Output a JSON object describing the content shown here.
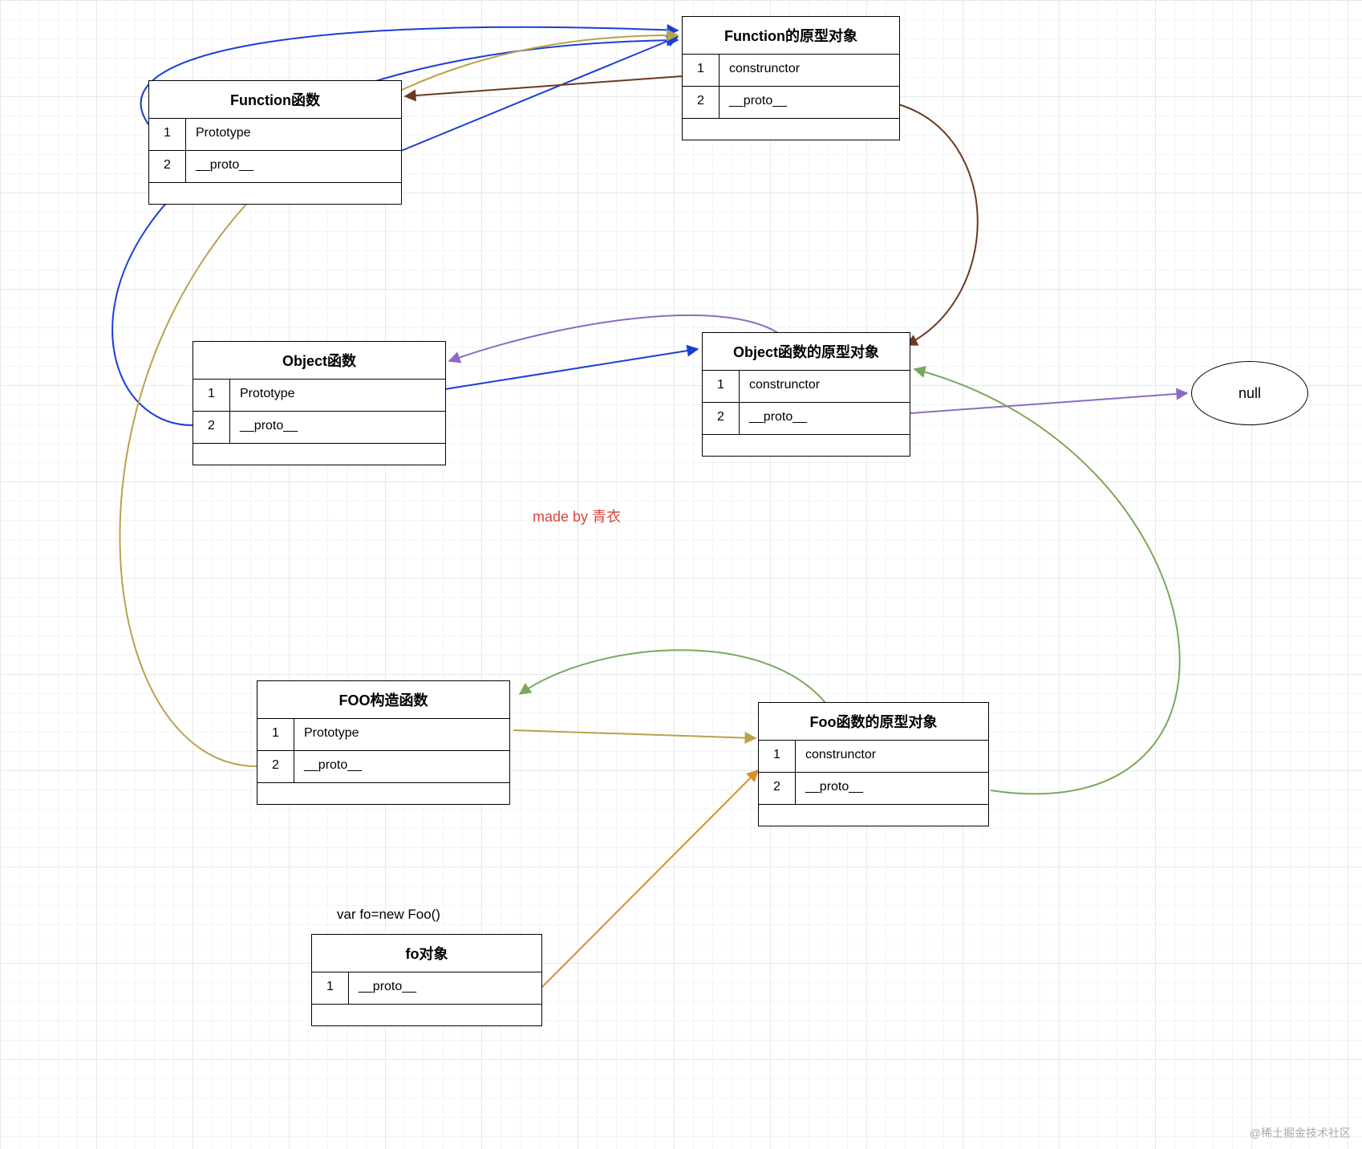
{
  "boxes": {
    "functionFn": {
      "title": "Function函数",
      "rows": [
        {
          "idx": "1",
          "val": "Prototype"
        },
        {
          "idx": "2",
          "val": "__proto__"
        }
      ]
    },
    "functionProto": {
      "title": "Function的原型对象",
      "rows": [
        {
          "idx": "1",
          "val": "construnctor"
        },
        {
          "idx": "2",
          "val": "__proto__"
        }
      ]
    },
    "objectFn": {
      "title": "Object函数",
      "rows": [
        {
          "idx": "1",
          "val": "Prototype"
        },
        {
          "idx": "2",
          "val": "__proto__"
        }
      ]
    },
    "objectProto": {
      "title": "Object函数的原型对象",
      "rows": [
        {
          "idx": "1",
          "val": "construnctor"
        },
        {
          "idx": "2",
          "val": "__proto__"
        }
      ]
    },
    "fooFn": {
      "title": "FOO构造函数",
      "rows": [
        {
          "idx": "1",
          "val": "Prototype"
        },
        {
          "idx": "2",
          "val": "__proto__"
        }
      ]
    },
    "fooProto": {
      "title": "Foo函数的原型对象",
      "rows": [
        {
          "idx": "1",
          "val": "construnctor"
        },
        {
          "idx": "2",
          "val": "__proto__"
        }
      ]
    },
    "foObj": {
      "title": "fo对象",
      "rows": [
        {
          "idx": "1",
          "val": "__proto__"
        }
      ]
    }
  },
  "nullNode": {
    "label": "null"
  },
  "annotation": "made by 青衣",
  "varLabel": "var fo=new Foo()",
  "watermark": "@稀土掘金技术社区",
  "arrows": {
    "colors": {
      "blue": "#1a3fd6",
      "brown": "#6b3a1e",
      "purple": "#8c6bbf",
      "olive": "#b9a24a",
      "green": "#7aa85a",
      "orange": "#d6902a"
    }
  }
}
